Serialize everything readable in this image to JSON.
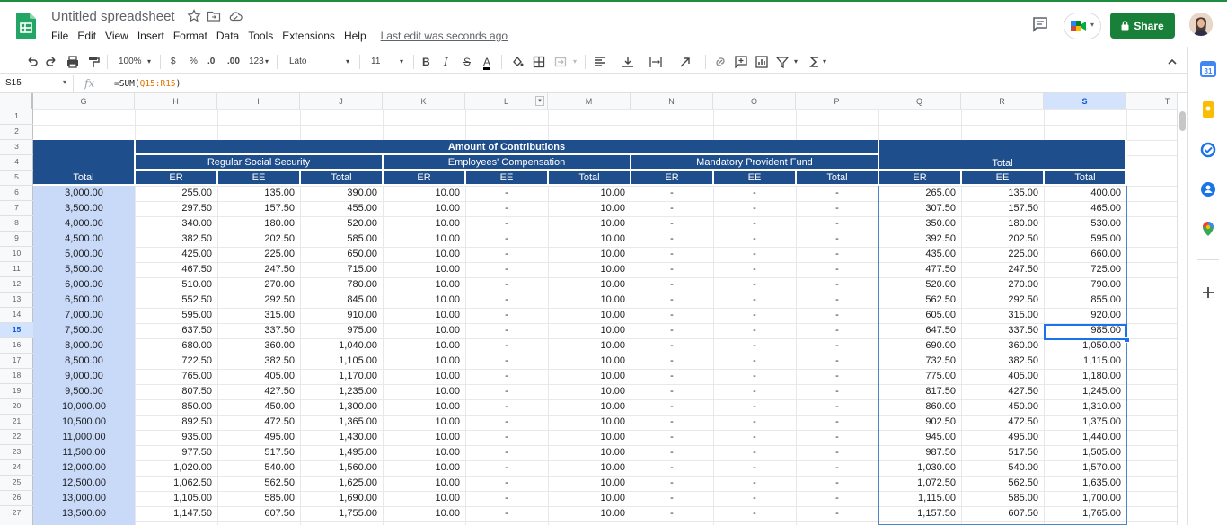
{
  "doc": {
    "title": "Untitled spreadsheet",
    "last_edit": "Last edit was seconds ago",
    "share_label": "Share"
  },
  "menu": [
    "File",
    "Edit",
    "View",
    "Insert",
    "Format",
    "Data",
    "Tools",
    "Extensions",
    "Help"
  ],
  "toolbar": {
    "zoom": "100%",
    "currency": "$",
    "percent": "%",
    "dec_less": ".0",
    "dec_more": ".00",
    "format_more": "123",
    "font": "Lato",
    "font_size": "11",
    "bold": "B",
    "italic": "I",
    "strike": "S",
    "text_color": "A"
  },
  "formula_bar": {
    "name_box": "S15",
    "fx": "fx",
    "formula_prefix": "=SUM(",
    "formula_ref": "Q15:R15",
    "formula_suffix": ")"
  },
  "columns": [
    "G",
    "H",
    "I",
    "J",
    "K",
    "L",
    "M",
    "N",
    "O",
    "P",
    "Q",
    "R",
    "S",
    "T"
  ],
  "selected_column": "S",
  "selected_row": 15,
  "rows": [
    1,
    2,
    3,
    4,
    5,
    6,
    7,
    8,
    9,
    10,
    11,
    12,
    13,
    14,
    15,
    16,
    17,
    18,
    19,
    20,
    21,
    22,
    23,
    24,
    25,
    26,
    27
  ],
  "headers": {
    "amount": "Amount of Contributions",
    "regular": "Regular Social Security",
    "employees_comp": "Employees' Compensation",
    "mpf": "Mandatory Provident Fund",
    "total_group": "Total",
    "g_total": "Total",
    "sub": [
      "ER",
      "EE",
      "Total",
      "ER",
      "EE",
      "Total",
      "ER",
      "EE",
      "Total",
      "ER",
      "EE",
      "Total"
    ]
  },
  "table": [
    [
      "3,000.00",
      "255.00",
      "135.00",
      "390.00",
      "10.00",
      "-",
      "10.00",
      "-",
      "-",
      "-",
      "265.00",
      "135.00",
      "400.00"
    ],
    [
      "3,500.00",
      "297.50",
      "157.50",
      "455.00",
      "10.00",
      "-",
      "10.00",
      "-",
      "-",
      "-",
      "307.50",
      "157.50",
      "465.00"
    ],
    [
      "4,000.00",
      "340.00",
      "180.00",
      "520.00",
      "10.00",
      "-",
      "10.00",
      "-",
      "-",
      "-",
      "350.00",
      "180.00",
      "530.00"
    ],
    [
      "4,500.00",
      "382.50",
      "202.50",
      "585.00",
      "10.00",
      "-",
      "10.00",
      "-",
      "-",
      "-",
      "392.50",
      "202.50",
      "595.00"
    ],
    [
      "5,000.00",
      "425.00",
      "225.00",
      "650.00",
      "10.00",
      "-",
      "10.00",
      "-",
      "-",
      "-",
      "435.00",
      "225.00",
      "660.00"
    ],
    [
      "5,500.00",
      "467.50",
      "247.50",
      "715.00",
      "10.00",
      "-",
      "10.00",
      "-",
      "-",
      "-",
      "477.50",
      "247.50",
      "725.00"
    ],
    [
      "6,000.00",
      "510.00",
      "270.00",
      "780.00",
      "10.00",
      "-",
      "10.00",
      "-",
      "-",
      "-",
      "520.00",
      "270.00",
      "790.00"
    ],
    [
      "6,500.00",
      "552.50",
      "292.50",
      "845.00",
      "10.00",
      "-",
      "10.00",
      "-",
      "-",
      "-",
      "562.50",
      "292.50",
      "855.00"
    ],
    [
      "7,000.00",
      "595.00",
      "315.00",
      "910.00",
      "10.00",
      "-",
      "10.00",
      "-",
      "-",
      "-",
      "605.00",
      "315.00",
      "920.00"
    ],
    [
      "7,500.00",
      "637.50",
      "337.50",
      "975.00",
      "10.00",
      "-",
      "10.00",
      "-",
      "-",
      "-",
      "647.50",
      "337.50",
      "985.00"
    ],
    [
      "8,000.00",
      "680.00",
      "360.00",
      "1,040.00",
      "10.00",
      "-",
      "10.00",
      "-",
      "-",
      "-",
      "690.00",
      "360.00",
      "1,050.00"
    ],
    [
      "8,500.00",
      "722.50",
      "382.50",
      "1,105.00",
      "10.00",
      "-",
      "10.00",
      "-",
      "-",
      "-",
      "732.50",
      "382.50",
      "1,115.00"
    ],
    [
      "9,000.00",
      "765.00",
      "405.00",
      "1,170.00",
      "10.00",
      "-",
      "10.00",
      "-",
      "-",
      "-",
      "775.00",
      "405.00",
      "1,180.00"
    ],
    [
      "9,500.00",
      "807.50",
      "427.50",
      "1,235.00",
      "10.00",
      "-",
      "10.00",
      "-",
      "-",
      "-",
      "817.50",
      "427.50",
      "1,245.00"
    ],
    [
      "10,000.00",
      "850.00",
      "450.00",
      "1,300.00",
      "10.00",
      "-",
      "10.00",
      "-",
      "-",
      "-",
      "860.00",
      "450.00",
      "1,310.00"
    ],
    [
      "10,500.00",
      "892.50",
      "472.50",
      "1,365.00",
      "10.00",
      "-",
      "10.00",
      "-",
      "-",
      "-",
      "902.50",
      "472.50",
      "1,375.00"
    ],
    [
      "11,000.00",
      "935.00",
      "495.00",
      "1,430.00",
      "10.00",
      "-",
      "10.00",
      "-",
      "-",
      "-",
      "945.00",
      "495.00",
      "1,440.00"
    ],
    [
      "11,500.00",
      "977.50",
      "517.50",
      "1,495.00",
      "10.00",
      "-",
      "10.00",
      "-",
      "-",
      "-",
      "987.50",
      "517.50",
      "1,505.00"
    ],
    [
      "12,000.00",
      "1,020.00",
      "540.00",
      "1,560.00",
      "10.00",
      "-",
      "10.00",
      "-",
      "-",
      "-",
      "1,030.00",
      "540.00",
      "1,570.00"
    ],
    [
      "12,500.00",
      "1,062.50",
      "562.50",
      "1,625.00",
      "10.00",
      "-",
      "10.00",
      "-",
      "-",
      "-",
      "1,072.50",
      "562.50",
      "1,635.00"
    ],
    [
      "13,000.00",
      "1,105.00",
      "585.00",
      "1,690.00",
      "10.00",
      "-",
      "10.00",
      "-",
      "-",
      "-",
      "1,115.00",
      "585.00",
      "1,700.00"
    ],
    [
      "13,500.00",
      "1,147.50",
      "607.50",
      "1,755.00",
      "10.00",
      "-",
      "10.00",
      "-",
      "-",
      "-",
      "1,157.50",
      "607.50",
      "1,765.00"
    ]
  ],
  "colors": {
    "header_blue": "#1f4e8c",
    "g_column": "#c9daf8",
    "share_green": "#188038",
    "selection": "#1a73e8"
  }
}
